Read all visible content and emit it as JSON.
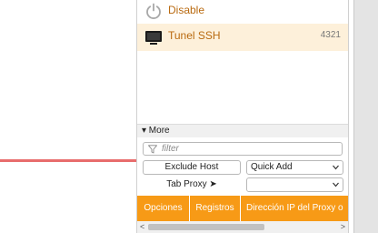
{
  "proxies": [
    {
      "name": "Disable",
      "icon": "power-icon",
      "port": ""
    },
    {
      "name": "Tunel SSH",
      "icon": "monitor-icon",
      "port": "4321"
    }
  ],
  "more_label": "▾ More",
  "filter": {
    "placeholder": "filter",
    "value": ""
  },
  "exclude_host_label": "Exclude Host",
  "quick_add": {
    "selected": "Quick Add"
  },
  "tab_proxy_label": "Tab Proxy ➤",
  "tab_proxy_select": {
    "selected": ""
  },
  "bottom_bar": {
    "opciones": "Opciones",
    "registros": "Registros",
    "direccion": "Dirección IP del Proxy o"
  },
  "scroll": {
    "left": "<",
    "right": ">"
  },
  "colors": {
    "accent": "#f79a16",
    "selected_row": "#fdf0da",
    "proxy_text": "#b96a10",
    "annotation_line": "#e86d6d"
  }
}
